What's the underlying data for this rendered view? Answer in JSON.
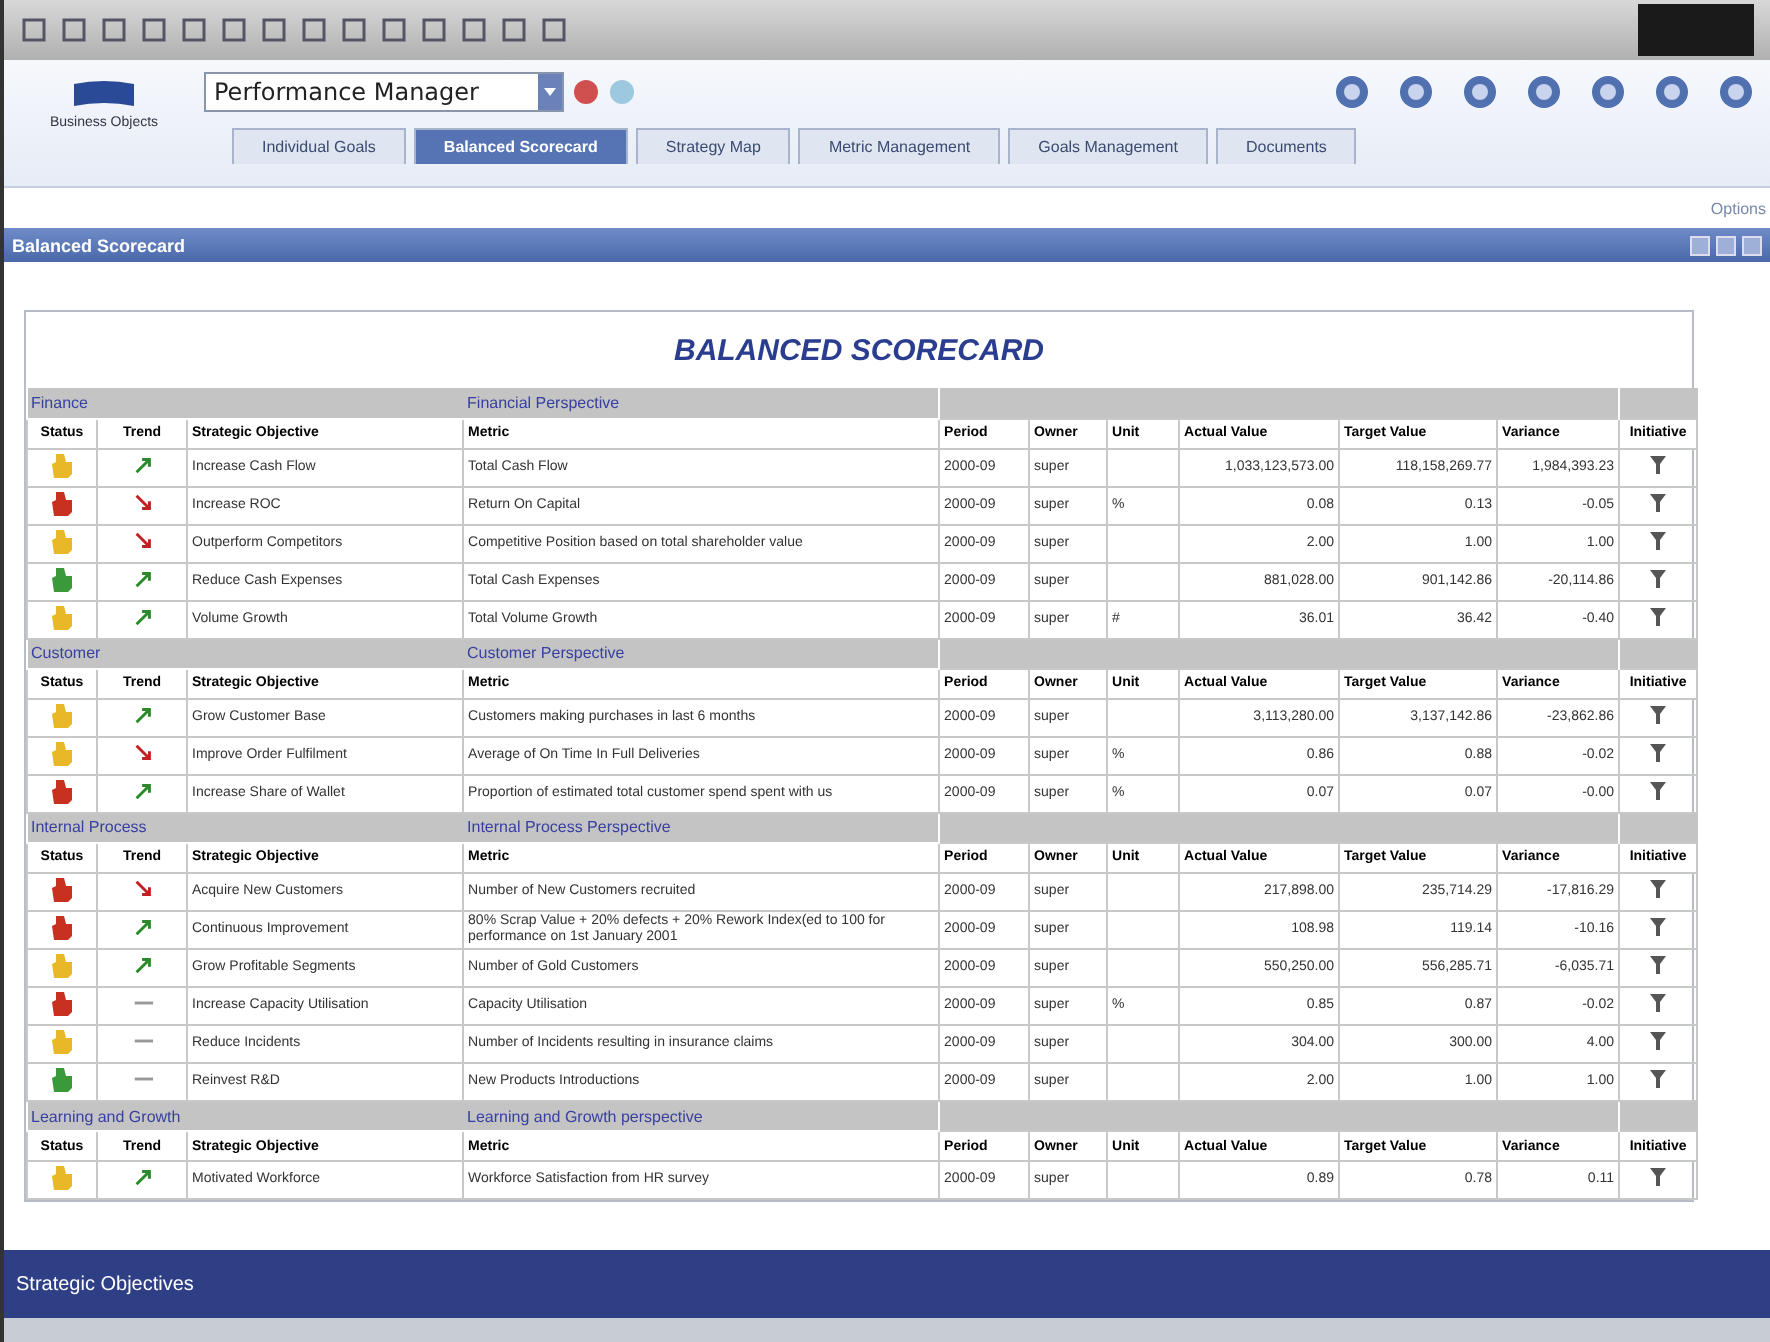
{
  "header": {
    "logo_caption": "Business Objects",
    "product_select": {
      "value": "Performance Manager"
    }
  },
  "tabs": [
    {
      "label": "Individual Goals",
      "selected": false
    },
    {
      "label": "Balanced Scorecard",
      "selected": true
    },
    {
      "label": "Strategy Map",
      "selected": false
    },
    {
      "label": "Metric Management",
      "selected": false
    },
    {
      "label": "Goals Management",
      "selected": false
    },
    {
      "label": "Documents",
      "selected": false
    }
  ],
  "options_link": "Options",
  "panel": {
    "title": "Balanced Scorecard"
  },
  "scorecard": {
    "title": "BALANCED SCORECARD",
    "sections": [
      {
        "name": "Finance",
        "perspective": "Financial Perspective",
        "columns": [
          "Status",
          "Trend",
          "Strategic Objective",
          "Metric",
          "Period",
          "Owner",
          "Unit",
          "Actual Value",
          "Target Value",
          "Variance",
          "Initiative"
        ],
        "rows": [
          {
            "color": "#e8b828",
            "kind": "up",
            "objective": "Increase Cash Flow",
            "metric": "Total Cash Flow",
            "period": "2000-09",
            "owner": "super",
            "actual": "1,033,123,573.00",
            "target": "118,158,269.77",
            "variance": "1,984,393.23"
          },
          {
            "color": "#c83020",
            "kind": "down",
            "objective": "Increase ROC",
            "metric": "Return On Capital",
            "period": "2000-09",
            "owner": "super",
            "unit": "%",
            "actual": "0.08",
            "target": "0.13",
            "variance": "-0.05"
          },
          {
            "color": "#e8b828",
            "kind": "down",
            "objective": "Outperform Competitors",
            "metric": "Competitive Position based on total shareholder value",
            "period": "2000-09",
            "owner": "super",
            "actual": "2.00",
            "target": "1.00",
            "variance": "1.00"
          },
          {
            "color": "#3a9a3a",
            "kind": "up",
            "objective": "Reduce Cash Expenses",
            "metric": "Total Cash Expenses",
            "period": "2000-09",
            "owner": "super",
            "actual": "881,028.00",
            "target": "901,142.86",
            "variance": "-20,114.86"
          },
          {
            "color": "#e8b828",
            "kind": "up",
            "objective": "Volume Growth",
            "metric": "Total Volume Growth",
            "period": "2000-09",
            "owner": "super",
            "unit": "#",
            "actual": "36.01",
            "target": "36.42",
            "variance": "-0.40"
          }
        ]
      },
      {
        "name": "Customer",
        "perspective": "Customer Perspective",
        "columns": [
          "Status",
          "Trend",
          "Strategic Objective",
          "Metric",
          "Period",
          "Owner",
          "Unit",
          "Actual Value",
          "Target Value",
          "Variance",
          "Initiative"
        ],
        "rows": [
          {
            "color": "#e8b828",
            "kind": "up",
            "objective": "Grow Customer Base",
            "metric": "Customers making purchases in last 6 months",
            "period": "2000-09",
            "owner": "super",
            "actual": "3,113,280.00",
            "target": "3,137,142.86",
            "variance": "-23,862.86"
          },
          {
            "color": "#e8b828",
            "kind": "down",
            "objective": "Improve Order Fulfilment",
            "metric": "Average of On Time In Full Deliveries",
            "period": "2000-09",
            "owner": "super",
            "unit": "%",
            "actual": "0.86",
            "target": "0.88",
            "variance": "-0.02"
          },
          {
            "color": "#c83020",
            "kind": "up",
            "objective": "Increase Share of Wallet",
            "metric": "Proportion of estimated total customer spend spent with us",
            "period": "2000-09",
            "owner": "super",
            "unit": "%",
            "actual": "0.07",
            "target": "0.07",
            "variance": "-0.00"
          }
        ]
      },
      {
        "name": "Internal Process",
        "perspective": "Internal Process Perspective",
        "columns": [
          "Status",
          "Trend",
          "Strategic Objective",
          "Metric",
          "Period",
          "Owner",
          "Unit",
          "Actual Value",
          "Target Value",
          "Variance",
          "Initiative"
        ],
        "rows": [
          {
            "color": "#c83020",
            "kind": "down",
            "objective": "Acquire New Customers",
            "metric": "Number of New Customers recruited",
            "period": "2000-09",
            "owner": "super",
            "actual": "217,898.00",
            "target": "235,714.29",
            "variance": "-17,816.29"
          },
          {
            "color": "#c83020",
            "kind": "up",
            "objective": "Continuous Improvement",
            "metric": "80% Scrap Value + 20% defects + 20% Rework Index(ed to 100 for performance on 1st January 2001",
            "period": "2000-09",
            "owner": "super",
            "actual": "108.98",
            "target": "119.14",
            "variance": "-10.16"
          },
          {
            "color": "#e8b828",
            "kind": "up",
            "objective": "Grow Profitable Segments",
            "metric": "Number of Gold Customers",
            "period": "2000-09",
            "owner": "super",
            "actual": "550,250.00",
            "target": "556,285.71",
            "variance": "-6,035.71"
          },
          {
            "color": "#c83020",
            "kind": "flat",
            "objective": "Increase Capacity Utilisation",
            "metric": "Capacity Utilisation",
            "period": "2000-09",
            "owner": "super",
            "unit": "%",
            "actual": "0.85",
            "target": "0.87",
            "variance": "-0.02"
          },
          {
            "color": "#e8b828",
            "kind": "flat",
            "objective": "Reduce Incidents",
            "metric": "Number of Incidents resulting in insurance claims",
            "period": "2000-09",
            "owner": "super",
            "actual": "304.00",
            "target": "300.00",
            "variance": "4.00"
          },
          {
            "color": "#3a9a3a",
            "kind": "flat",
            "objective": "Reinvest R&D",
            "metric": "New Products Introductions",
            "period": "2000-09",
            "owner": "super",
            "actual": "2.00",
            "target": "1.00",
            "variance": "1.00"
          }
        ]
      },
      {
        "name": "Learning and Growth",
        "perspective": "Learning and Growth perspective",
        "columns": [
          "Status",
          "Trend",
          "Strategic Objective",
          "Metric",
          "Period",
          "Owner",
          "Unit",
          "Actual Value",
          "Target Value",
          "Variance",
          "Initiative"
        ],
        "rows": [
          {
            "color": "#e8b828",
            "kind": "up",
            "objective": "Motivated Workforce",
            "metric": "Workforce Satisfaction from HR survey",
            "period": "2000-09",
            "owner": "super",
            "actual": "0.89",
            "target": "0.78",
            "variance": "0.11"
          }
        ]
      }
    ]
  },
  "footer": {
    "title": "Strategic Objectives"
  }
}
